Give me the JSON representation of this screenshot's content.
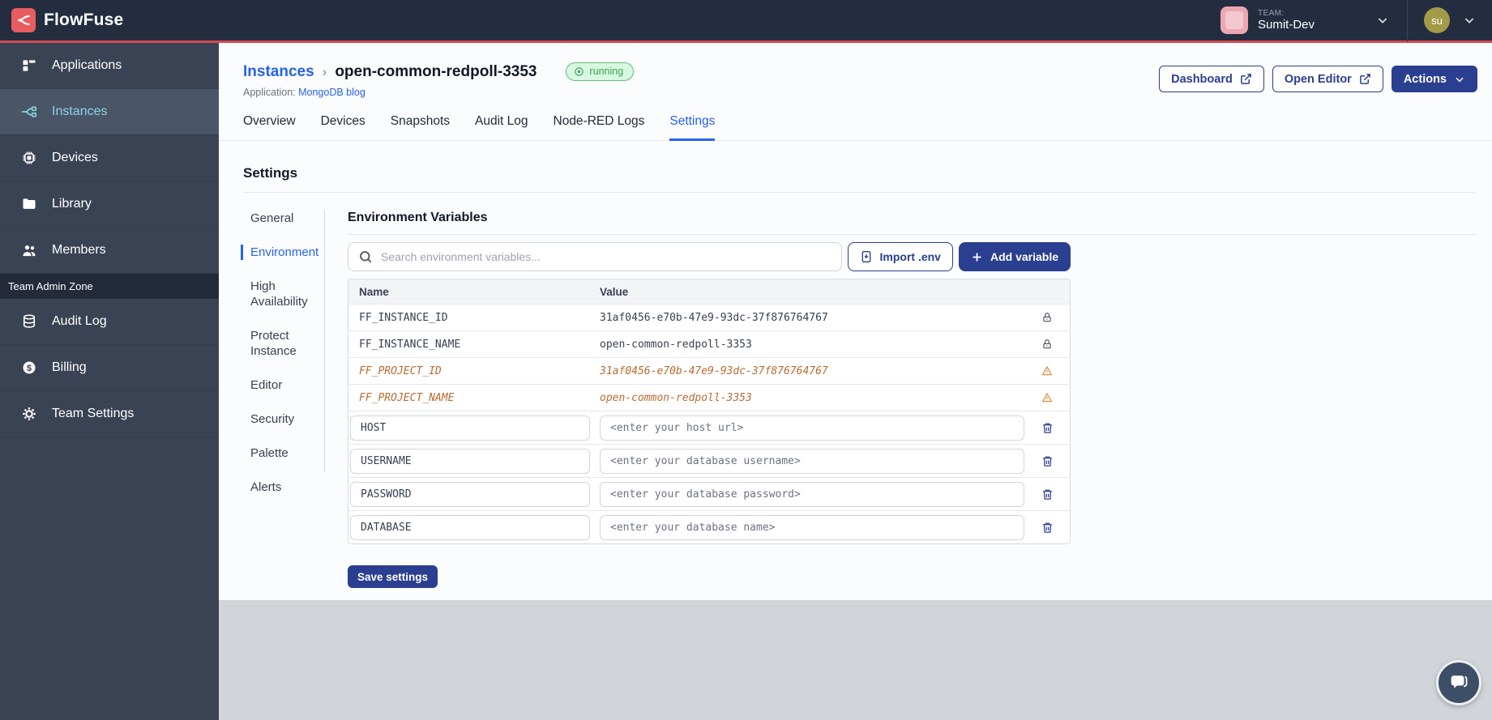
{
  "topbar": {
    "brand": "FlowFuse",
    "team": {
      "label": "TEAM:",
      "name": "Sumit-Dev"
    },
    "avatar_initials": "su"
  },
  "sidebar": {
    "items": [
      {
        "label": "Applications",
        "icon": "applications-icon",
        "active": false
      },
      {
        "label": "Instances",
        "icon": "instances-icon",
        "active": true
      },
      {
        "label": "Devices",
        "icon": "devices-icon",
        "active": false
      },
      {
        "label": "Library",
        "icon": "library-icon",
        "active": false
      },
      {
        "label": "Members",
        "icon": "members-icon",
        "active": false
      }
    ],
    "admin_zone_label": "Team Admin Zone",
    "admin_items": [
      {
        "label": "Audit Log",
        "icon": "audit-log-icon"
      },
      {
        "label": "Billing",
        "icon": "billing-icon"
      },
      {
        "label": "Team Settings",
        "icon": "team-settings-icon"
      }
    ]
  },
  "header": {
    "breadcrumb": {
      "root": "Instances",
      "separator": "›",
      "current": "open-common-redpoll-3353"
    },
    "status_badge": "running",
    "application_label": "Application:",
    "application_name": "MongoDB blog",
    "dashboard_button": "Dashboard",
    "open_editor_button": "Open Editor",
    "actions_button": "Actions"
  },
  "tabs": {
    "items": [
      {
        "label": "Overview",
        "active": false
      },
      {
        "label": "Devices",
        "active": false
      },
      {
        "label": "Snapshots",
        "active": false
      },
      {
        "label": "Audit Log",
        "active": false
      },
      {
        "label": "Node-RED Logs",
        "active": false
      },
      {
        "label": "Settings",
        "active": true
      }
    ]
  },
  "settings": {
    "title": "Settings",
    "nav": [
      {
        "label": "General",
        "active": false
      },
      {
        "label": "Environment",
        "active": true
      },
      {
        "label": "High Availability",
        "active": false
      },
      {
        "label": "Protect Instance",
        "active": false
      },
      {
        "label": "Editor",
        "active": false
      },
      {
        "label": "Security",
        "active": false
      },
      {
        "label": "Palette",
        "active": false
      },
      {
        "label": "Alerts",
        "active": false
      }
    ]
  },
  "env": {
    "title": "Environment Variables",
    "search_placeholder": "Search environment variables...",
    "import_button": "Import .env",
    "add_button": "Add variable",
    "columns": {
      "name": "Name",
      "value": "Value"
    },
    "locked_rows": [
      {
        "name": "FF_INSTANCE_ID",
        "value": "31af0456-e70b-47e9-93dc-37f876764767"
      },
      {
        "name": "FF_INSTANCE_NAME",
        "value": "open-common-redpoll-3353"
      }
    ],
    "deprecated_rows": [
      {
        "name": "FF_PROJECT_ID",
        "value": "31af0456-e70b-47e9-93dc-37f876764767"
      },
      {
        "name": "FF_PROJECT_NAME",
        "value": "open-common-redpoll-3353"
      }
    ],
    "editable_rows": [
      {
        "name": "HOST",
        "value_placeholder": "<enter your host url>"
      },
      {
        "name": "USERNAME",
        "value_placeholder": "<enter your database username>"
      },
      {
        "name": "PASSWORD",
        "value_placeholder": "<enter your database password>"
      },
      {
        "name": "DATABASE",
        "value_placeholder": "<enter your database name>"
      }
    ],
    "save_button": "Save settings"
  },
  "colors": {
    "topbar": "#242d40",
    "red_line": "#d6494f",
    "logo_red": "#e85d60",
    "sidebar": "#3a4354",
    "sidebar_active": "#89d6e1",
    "accent": "#2563eb",
    "navy": "#2a3f8f",
    "badge_green": "#3aa356",
    "badge_bg": "#d9f7e1",
    "warning": "#bc6b31",
    "footer": "#d1d5da",
    "avatar": "#a39a48",
    "team_tile": "#eba8b2"
  },
  "icons": {
    "flowfuse-logo-icon": "branch-merge",
    "search-icon": "magnifier",
    "external-link-icon": "box-arrow",
    "chevron-down-icon": "⌄",
    "plus-icon": "+",
    "import-env-icon": "document-down-arrow",
    "lock-icon": "padlock",
    "warning-icon": "triangle",
    "trash-icon": "trash-can",
    "running-icon": "dot-circle",
    "chat-icon": "speech-bubbles"
  }
}
